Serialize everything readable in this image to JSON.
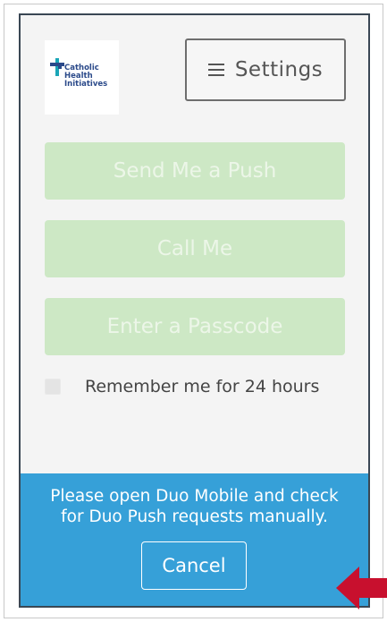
{
  "logo": {
    "lines": [
      "Catholic",
      "Health",
      "Initiatives"
    ]
  },
  "settings": {
    "icon": "hamburger-menu-icon",
    "label": "Settings"
  },
  "auth_buttons": [
    {
      "label": "Send Me a Push"
    },
    {
      "label": "Call Me"
    },
    {
      "label": "Enter a Passcode"
    }
  ],
  "remember": {
    "label": "Remember me for 24 hours",
    "checked": false
  },
  "status": {
    "line1": "Please open Duo Mobile and check",
    "line2": "for Duo Push requests manually."
  },
  "cancel": {
    "label": "Cancel"
  },
  "colors": {
    "status_blue": "#36a0d8",
    "disabled_green": "#cde8c5",
    "arrow_red": "#c8102e",
    "logo_blue": "#2b4a8a",
    "logo_teal": "#1aa6b7"
  }
}
